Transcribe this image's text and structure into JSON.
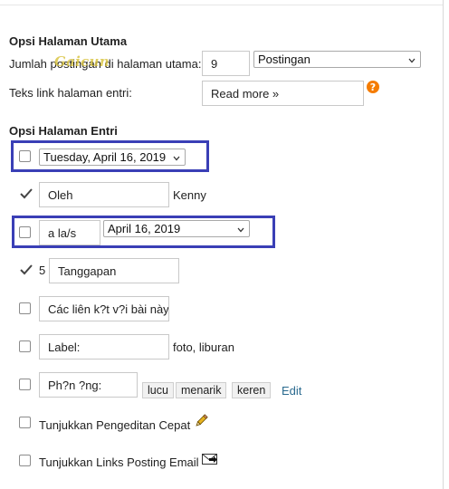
{
  "main_page_options": {
    "title": "Opsi Halaman Utama",
    "posts_count_label": "Jumlah postingan di halaman utama:",
    "posts_count_value": "9",
    "posts_unit_select": "Postingan",
    "read_more_label": "Teks link halaman entri:",
    "read_more_value": "Read more »",
    "help_icon_glyph": "?",
    "watermark_text": "Gaicun"
  },
  "post_page_options": {
    "title": "Opsi Halaman Entri",
    "rows": {
      "date_header": {
        "checked": false,
        "select": "Tuesday, April 16, 2019"
      },
      "author": {
        "checked": true,
        "field": "Oleh",
        "value": "Kenny"
      },
      "timestamp": {
        "checked": false,
        "field": "a la/s",
        "select": "April 16, 2019"
      },
      "comments": {
        "checked": true,
        "count": "5",
        "field": "Tanggapan"
      },
      "backlinks": {
        "checked": false,
        "field": "Các liên k?t v?i bài này"
      },
      "labels": {
        "checked": false,
        "field": "Label:",
        "value": "foto, liburan"
      },
      "reactions": {
        "checked": false,
        "field": "Ph?n ?ng:",
        "chips": [
          "lucu",
          "menarik",
          "keren"
        ],
        "edit_link": "Edit"
      },
      "quick_edit": {
        "checked": false,
        "label": "Tunjukkan Pengeditan Cepat"
      },
      "email_links": {
        "checked": false,
        "label": "Tunjukkan Links Posting Email"
      }
    }
  },
  "colors": {
    "highlight_border": "#3a3fb6",
    "help_icon": "#f57c00",
    "edit_link": "#2a6a8f",
    "watermark": "#d8c23a"
  },
  "icons": {
    "checkbox_checked": "checkmark-icon",
    "quick_edit": "pencil-icon",
    "email": "email-forward-icon",
    "help": "help-icon",
    "select": "chevron-down-icon"
  }
}
